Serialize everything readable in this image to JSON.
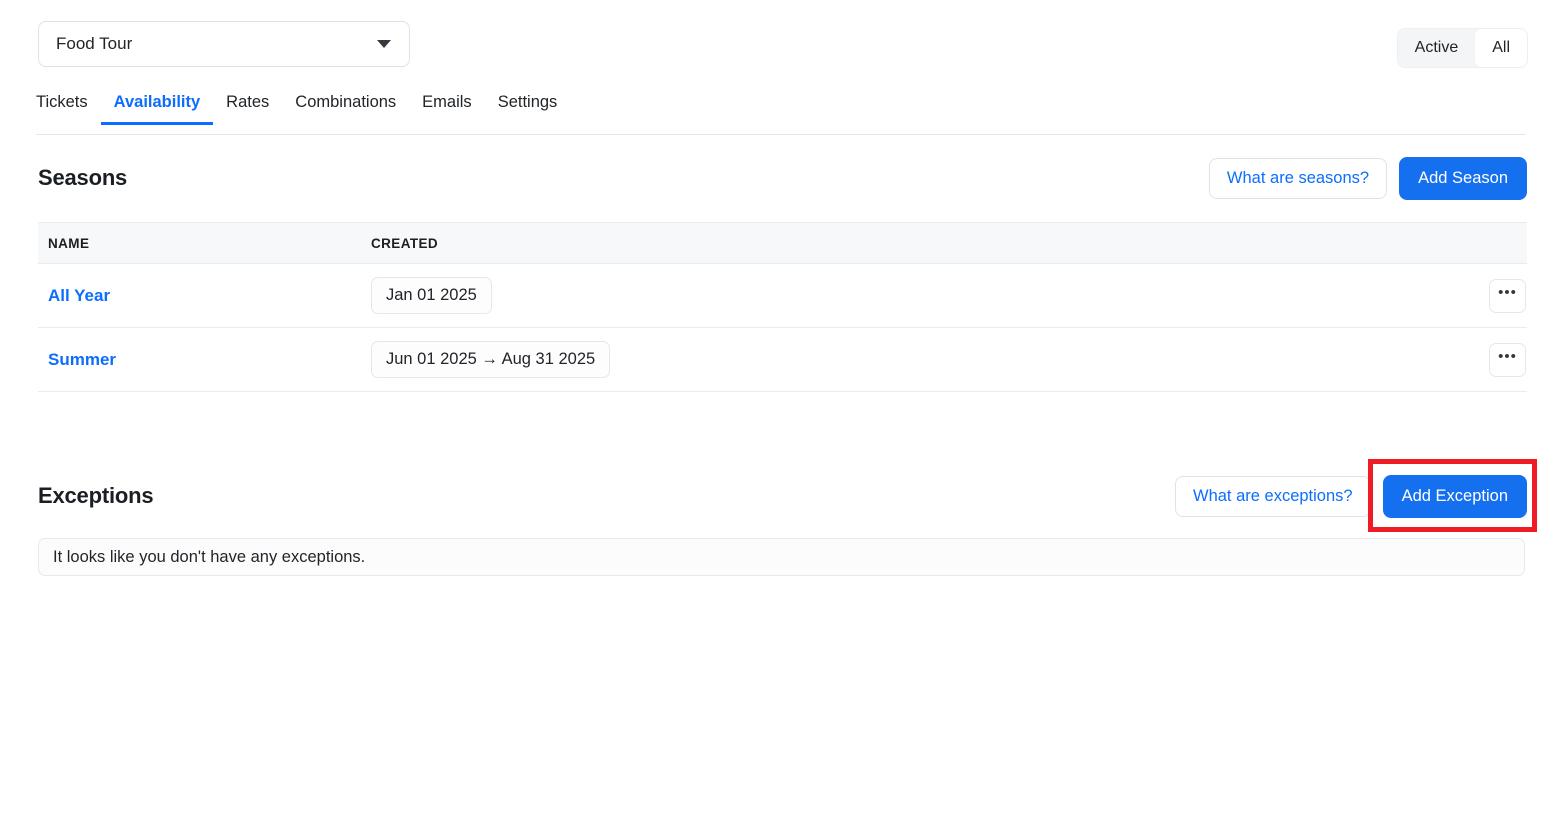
{
  "topbar": {
    "product_select": {
      "value": "Food Tour",
      "icon": "chevron-down-icon"
    },
    "filter_toggle": {
      "options": [
        {
          "label": "Active",
          "selected": false
        },
        {
          "label": "All",
          "selected": true
        }
      ]
    }
  },
  "tabs": [
    {
      "label": "Tickets",
      "active": false
    },
    {
      "label": "Availability",
      "active": true
    },
    {
      "label": "Rates",
      "active": false
    },
    {
      "label": "Combinations",
      "active": false
    },
    {
      "label": "Emails",
      "active": false
    },
    {
      "label": "Settings",
      "active": false
    }
  ],
  "seasons": {
    "title": "Seasons",
    "help_button": "What are seasons?",
    "add_button": "Add Season",
    "columns": [
      "NAME",
      "CREATED"
    ],
    "rows": [
      {
        "name": "All Year",
        "created": "Jan 01 2025",
        "menu": "•••"
      },
      {
        "name": "Summer",
        "created": "Jun 01 2025 → Aug 31 2025",
        "menu": "•••"
      }
    ]
  },
  "exceptions": {
    "title": "Exceptions",
    "help_button": "What are exceptions?",
    "add_button": "Add Exception",
    "empty_message": "It looks like you don't have any exceptions."
  },
  "annotation": {
    "highlight_color": "#ee1c25",
    "target": "Add Exception"
  },
  "colors": {
    "accent_blue": "#0d6efd",
    "primary_button": "#1570f0",
    "header_row_bg": "#f7f8f9",
    "border": "#e9ecef"
  }
}
